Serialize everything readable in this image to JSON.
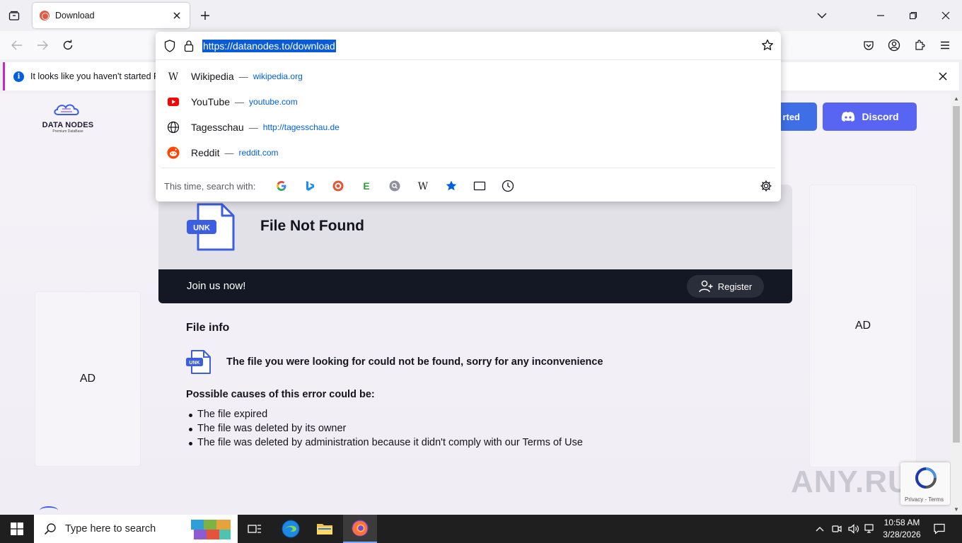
{
  "browser": {
    "tab_title": "Download",
    "url": "https://datanodes.to/download",
    "notification": "It looks like you haven't started Fi"
  },
  "suggestions": [
    {
      "title": "Wikipedia",
      "url": "wikipedia.org",
      "icon": "wikipedia-icon"
    },
    {
      "title": "YouTube",
      "url": "youtube.com",
      "icon": "youtube-icon"
    },
    {
      "title": "Tagesschau",
      "url": "http://tagesschau.de",
      "icon": "globe-icon"
    },
    {
      "title": "Reddit",
      "url": "reddit.com",
      "icon": "reddit-icon"
    }
  ],
  "search_with": {
    "label": "This time, search with:",
    "engines": [
      "google",
      "bing",
      "duckduckgo",
      "ecosia",
      "search",
      "wikipedia",
      "bookmarks",
      "tabs",
      "history"
    ]
  },
  "site": {
    "logo_name_bold": "DATA NODES",
    "logo_sub": "Premium DataBase",
    "header_button_partial": "rted",
    "discord_label": "Discord",
    "ad_label": "AD",
    "file_badge": "UNK",
    "file_title": "File Not Found",
    "join_text": "Join us now!",
    "register_label": "Register",
    "file_info_title": "File info",
    "not_found_message": "The file you were looking for could not be found, sorry for any inconvenience",
    "causes_title": "Possible causes of this error could be:",
    "causes": [
      "The file expired",
      "The file was deleted by its owner",
      "The file was deleted by administration because it didn't comply with our Terms of Use"
    ]
  },
  "recaptcha_text": "Privacy - Terms",
  "watermark": "ANY.RUN",
  "taskbar": {
    "search_placeholder": "Type here to search",
    "time": "10:58 AM",
    "date": "3/28/2026"
  },
  "colors": {
    "accent_blue": "#3f6fe6",
    "discord": "#5865f2",
    "dark_bar": "#141824",
    "url_highlight": "#0a5bd6"
  }
}
